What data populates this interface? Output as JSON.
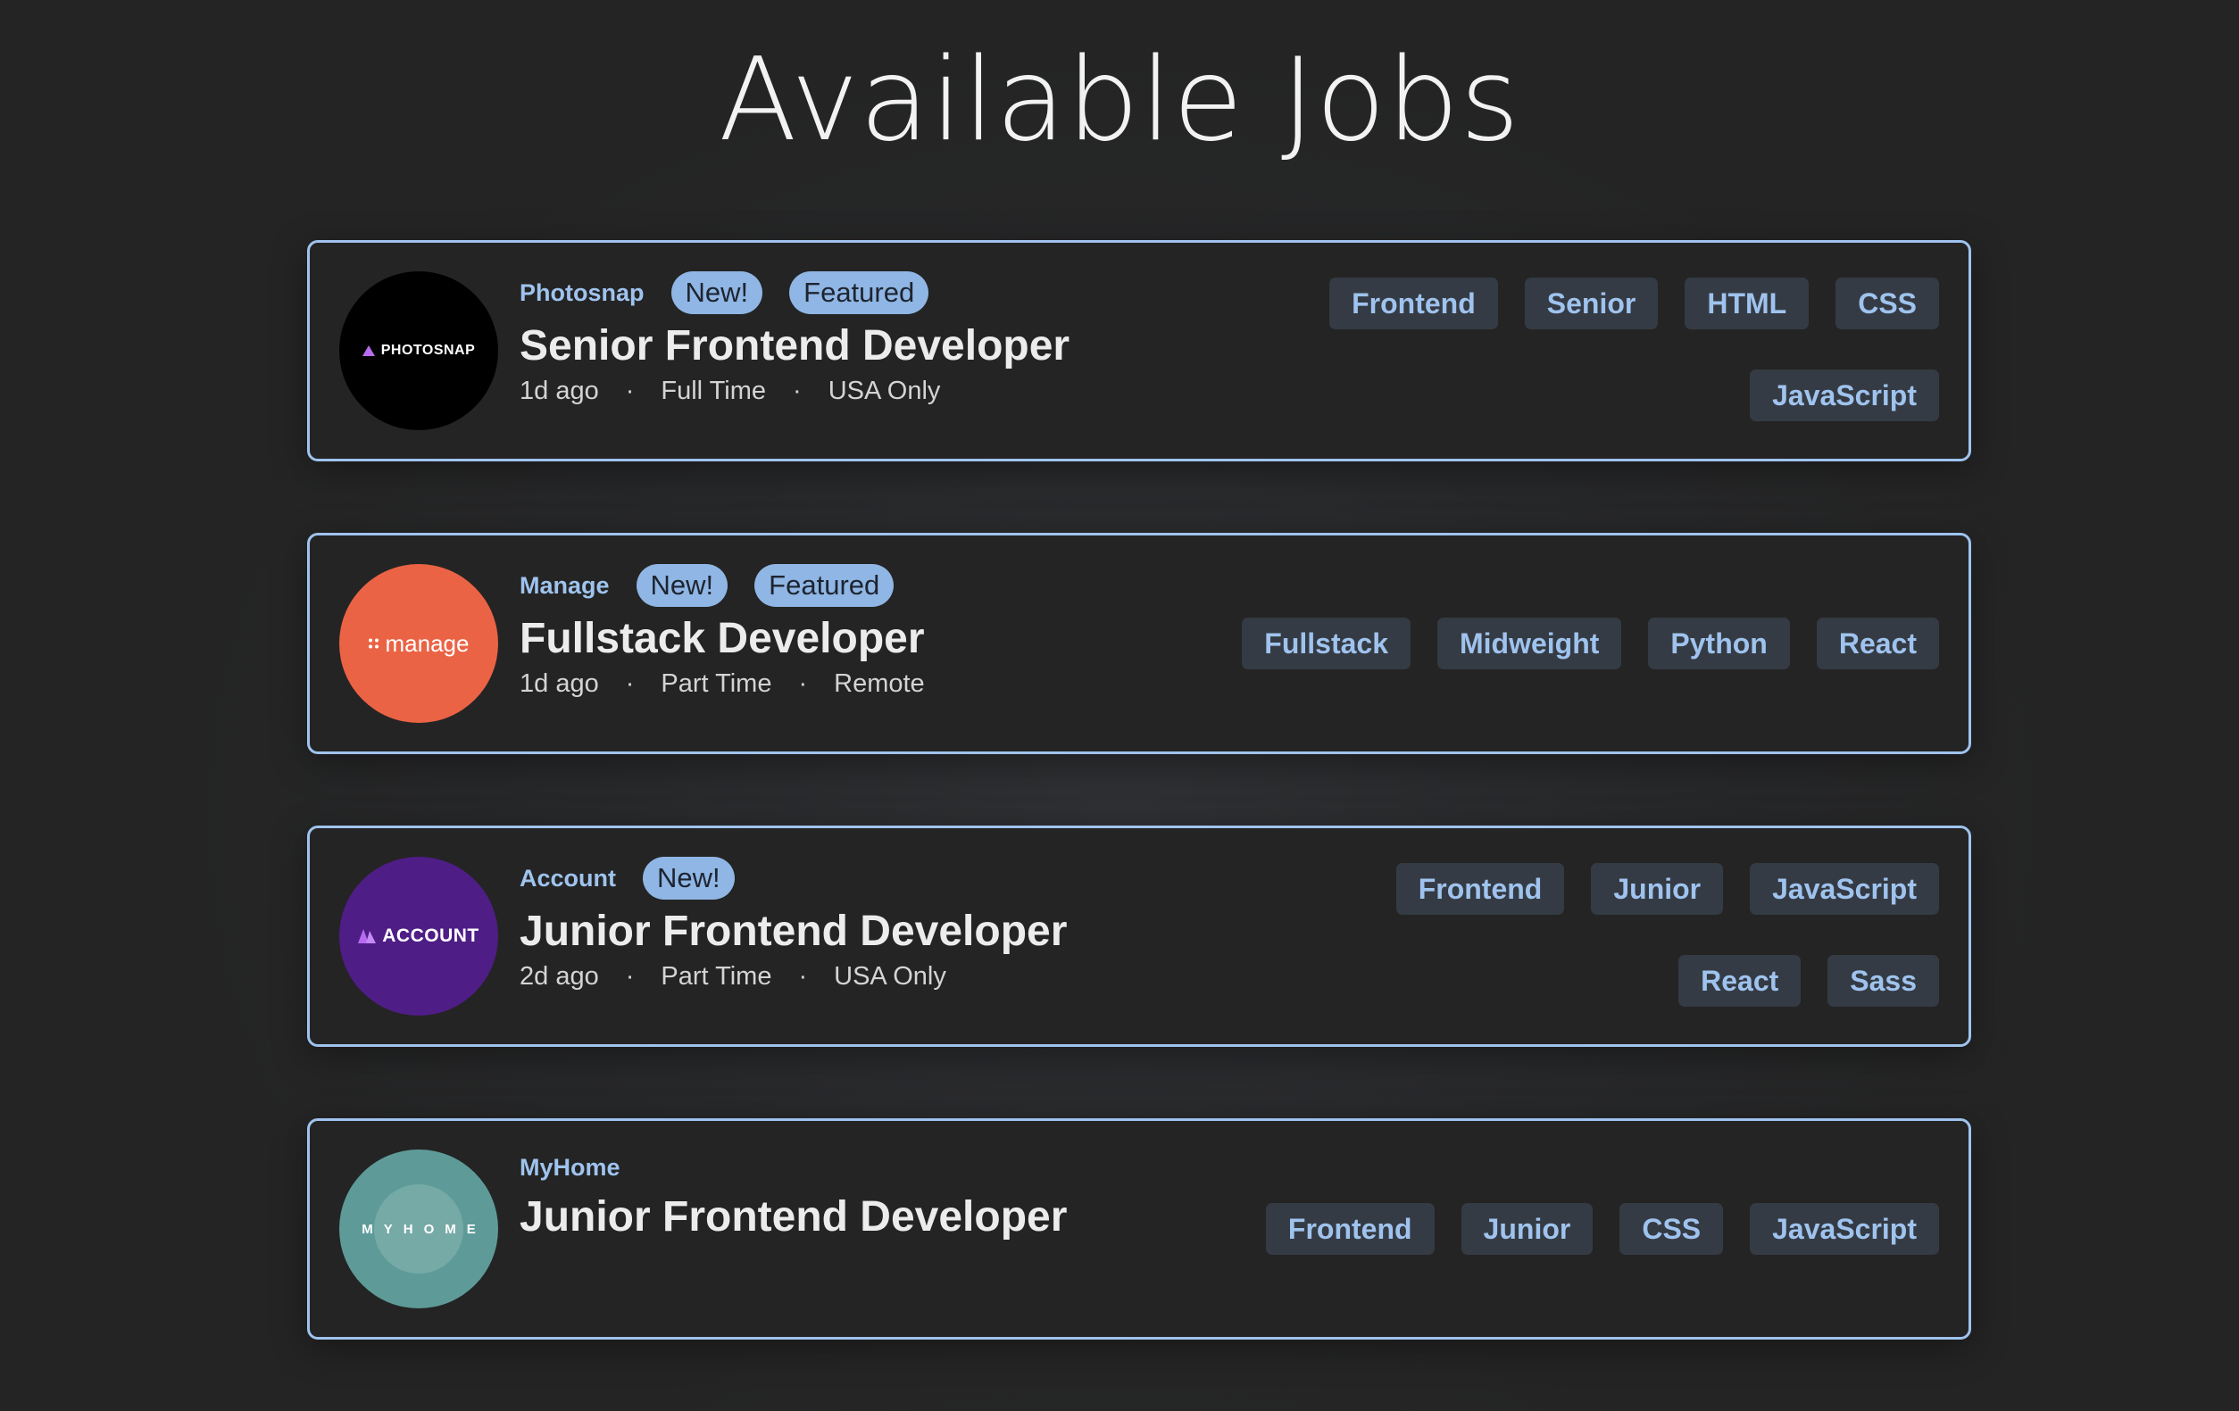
{
  "page": {
    "title": "Available Jobs"
  },
  "jobs": [
    {
      "company": "Photosnap",
      "logo_text": "PHOTOSNAP",
      "logo_color": "#000000",
      "badges": [
        "New!",
        "Featured"
      ],
      "position": "Senior Frontend Developer",
      "posted": "1d ago",
      "contract": "Full Time",
      "location": "USA Only",
      "tags": [
        "Frontend",
        "Senior",
        "HTML",
        "CSS",
        "JavaScript"
      ]
    },
    {
      "company": "Manage",
      "logo_text": "manage",
      "logo_color": "#eb6345",
      "badges": [
        "New!",
        "Featured"
      ],
      "position": "Fullstack Developer",
      "posted": "1d ago",
      "contract": "Part Time",
      "location": "Remote",
      "tags": [
        "Fullstack",
        "Midweight",
        "Python",
        "React"
      ]
    },
    {
      "company": "Account",
      "logo_text": "ACCOUNT",
      "logo_color": "#4f1d86",
      "badges": [
        "New!"
      ],
      "position": "Junior Frontend Developer",
      "posted": "2d ago",
      "contract": "Part Time",
      "location": "USA Only",
      "tags": [
        "Frontend",
        "Junior",
        "JavaScript",
        "React",
        "Sass"
      ]
    },
    {
      "company": "MyHome",
      "logo_text": "MYHOME",
      "logo_color": "#5e9b98",
      "badges": [],
      "position": "Junior Frontend Developer",
      "tags": [
        "Frontend",
        "Junior",
        "CSS",
        "JavaScript"
      ]
    }
  ],
  "meta_separator": "·",
  "colors": {
    "background": "#242424",
    "accent": "#9fc3ee",
    "badge_bg": "#8fb6e4",
    "tag_bg": "#353b44"
  }
}
